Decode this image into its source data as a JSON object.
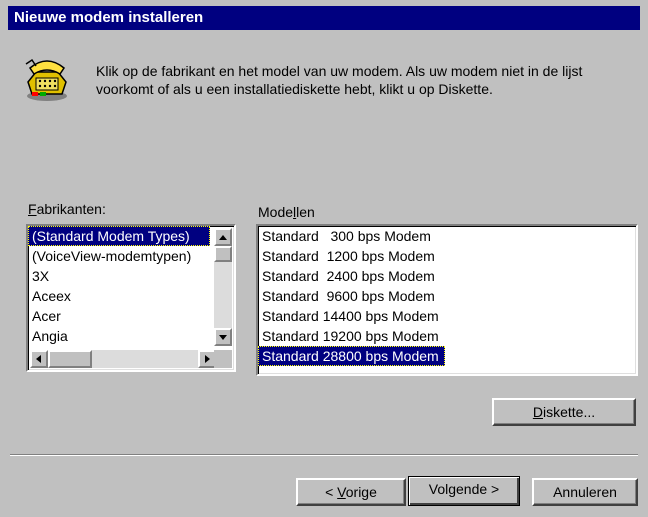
{
  "window": {
    "title": "Nieuwe modem installeren"
  },
  "intro_text": "Klik op de fabrikant en het model van uw modem. Als uw modem niet in de lijst voorkomt of als u een installatiediskette hebt, klikt u op Diskette.",
  "manufacturers": {
    "label_accel": "F",
    "label_rest": "abrikanten:",
    "items": [
      "(Standard Modem Types)",
      "(VoiceView-modemtypen)",
      "3X",
      "Aceex",
      "Acer",
      "Angia"
    ],
    "selected_index": 0
  },
  "models": {
    "label_pre": "Mode",
    "label_accel": "l",
    "label_post": "len",
    "items": [
      "Standard   300 bps Modem",
      "Standard  1200 bps Modem",
      "Standard  2400 bps Modem",
      "Standard  9600 bps Modem",
      "Standard 14400 bps Modem",
      "Standard 19200 bps Modem",
      "Standard 28800 bps Modem"
    ],
    "selected_index": 6
  },
  "buttons": {
    "disk_accel": "D",
    "disk_rest": "iskette...",
    "prev_pre": "< ",
    "prev_accel": "V",
    "prev_rest": "orige",
    "next_label": "Volgende >",
    "cancel_label": "Annuleren"
  },
  "colors": {
    "face": "#c0c0c0",
    "titlebar": "#000080",
    "selection": "#000080"
  },
  "icons": {
    "header": "modem-phone-icon"
  }
}
